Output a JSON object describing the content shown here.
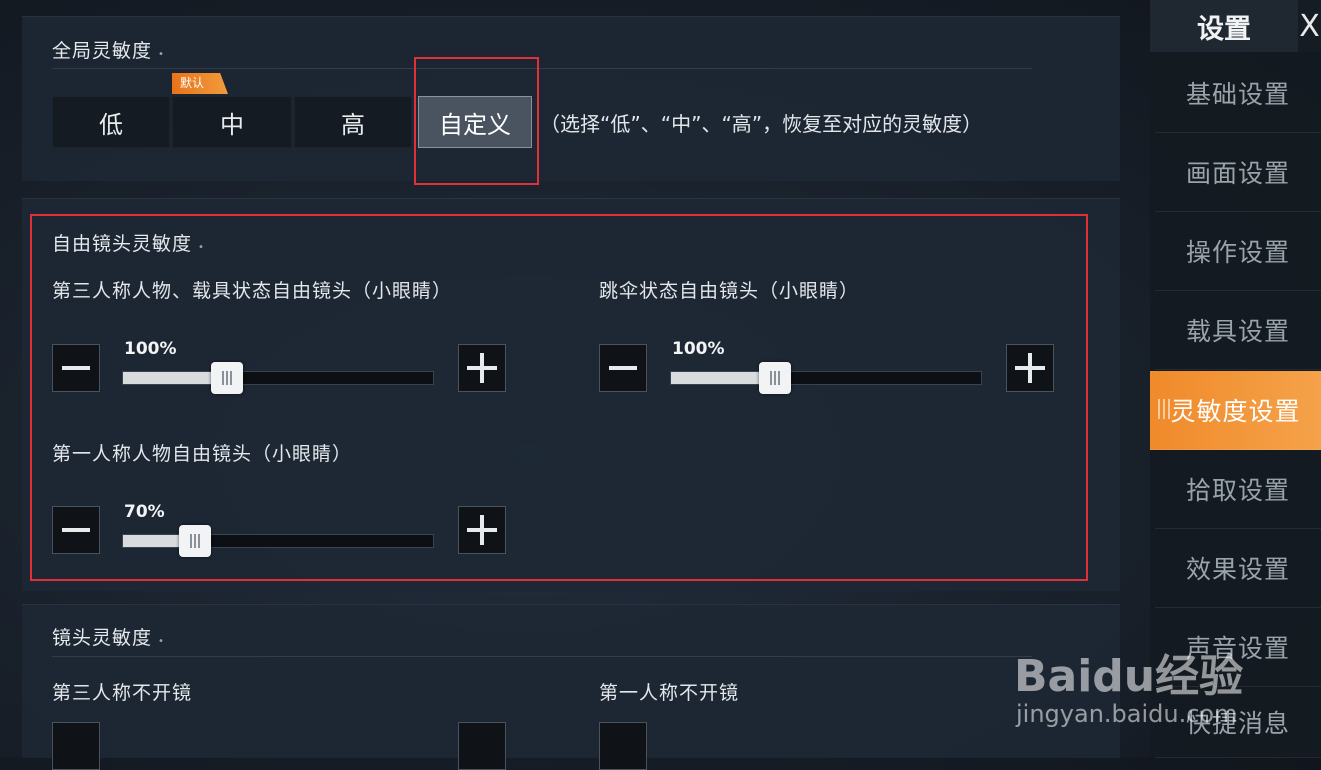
{
  "global_sensitivity": {
    "title": "全局灵敏度",
    "default_badge": "默认",
    "options": [
      "低",
      "中",
      "高",
      "自定义"
    ],
    "selected": "自定义",
    "hint": "（选择“低”、“中”、“高”，恢复至对应的灵敏度）"
  },
  "free_camera": {
    "title": "自由镜头灵敏度",
    "third_person_vehicle": {
      "label": "第三人称人物、载具状态自由镜头（小眼睛）",
      "value": 100,
      "value_text": "100%"
    },
    "parachute": {
      "label": "跳伞状态自由镜头（小眼睛）",
      "value": 100,
      "value_text": "100%"
    },
    "first_person": {
      "label": "第一人称人物自由镜头（小眼睛）",
      "value": 70,
      "value_text": "70%"
    }
  },
  "camera_sensitivity": {
    "title": "镜头灵敏度",
    "third_person_no_scope": "第三人称不开镜",
    "first_person_no_scope": "第一人称不开镜"
  },
  "sidebar": {
    "title": "设置",
    "close": "X",
    "items": [
      "基础设置",
      "画面设置",
      "操作设置",
      "载具设置",
      "灵敏度设置",
      "拾取设置",
      "效果设置",
      "声音设置",
      "快捷消息"
    ],
    "active": "灵敏度设置"
  },
  "watermark": {
    "logo": "Baidu经验",
    "url": "jingyan.baidu.com"
  },
  "colors": {
    "accent": "#f08a2a",
    "highlight_box": "#e0303a",
    "badge": "#e8731a"
  }
}
